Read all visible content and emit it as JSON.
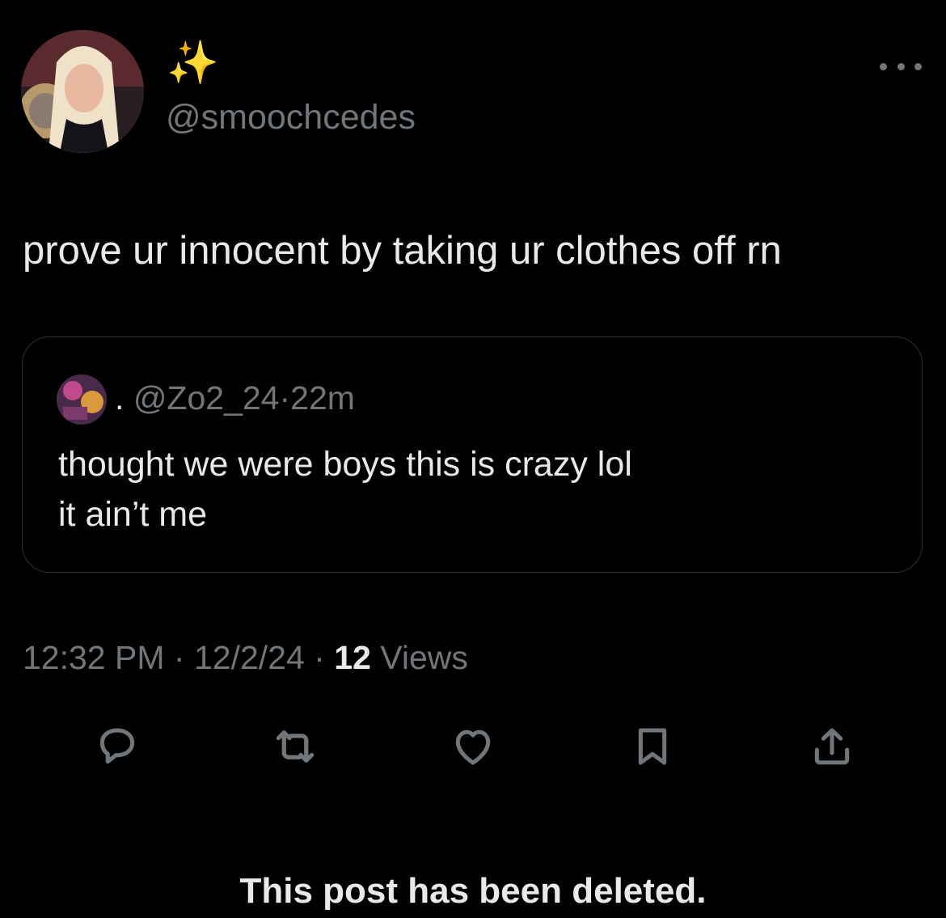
{
  "author": {
    "display_name": "✨",
    "handle": "@smoochcedes",
    "avatar": "profile-photo-icon"
  },
  "post": {
    "text": "prove ur innocent by taking ur clothes off rn"
  },
  "quoted_post": {
    "display_name": ".",
    "handle": "@Zo2_24",
    "separator": "·",
    "time": "22m",
    "text": "thought we were boys this is crazy lol\nit ain’t me",
    "avatar": "profile-photo-icon"
  },
  "meta": {
    "time": "12:32 PM",
    "separator": "·",
    "date": "12/2/24",
    "views_count": "12",
    "views_label": "Views"
  },
  "actions": [
    "reply-icon",
    "repost-icon",
    "like-icon",
    "bookmark-icon",
    "share-icon"
  ],
  "notice": {
    "deleted": "This post has been deleted."
  },
  "colors": {
    "background": "#000000",
    "primary_text": "#e7e9ea",
    "secondary_text": "#71767b",
    "border": "#2f3336"
  }
}
